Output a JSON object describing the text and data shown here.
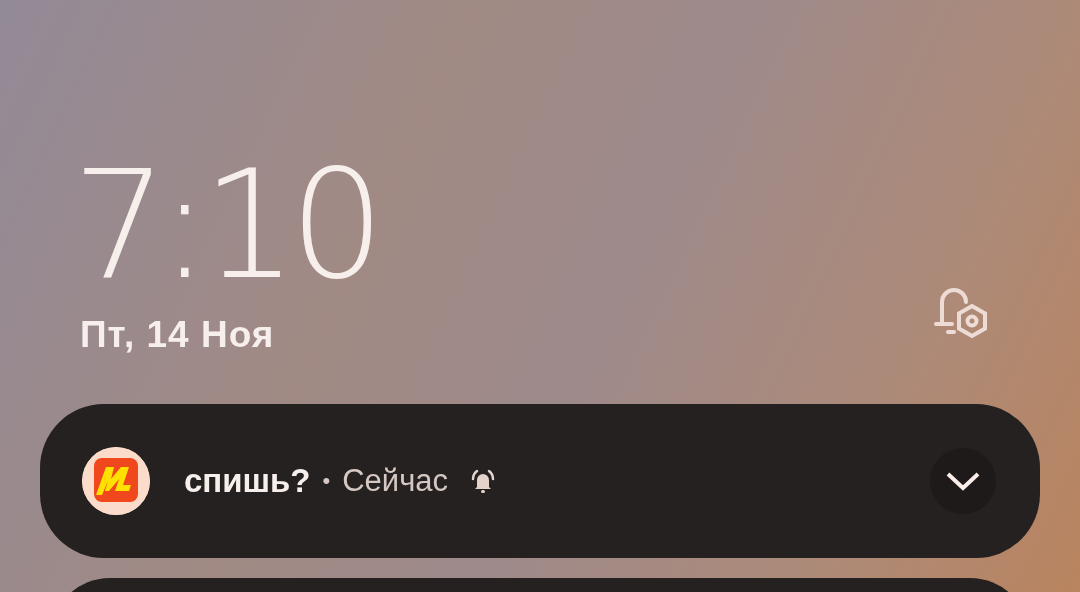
{
  "clock": {
    "time": "7:10",
    "date": "Пт, 14 Ноя"
  },
  "notifications": [
    {
      "title": "спишь?",
      "separator": "•",
      "time": "Сейчас",
      "expanded": false
    }
  ]
}
